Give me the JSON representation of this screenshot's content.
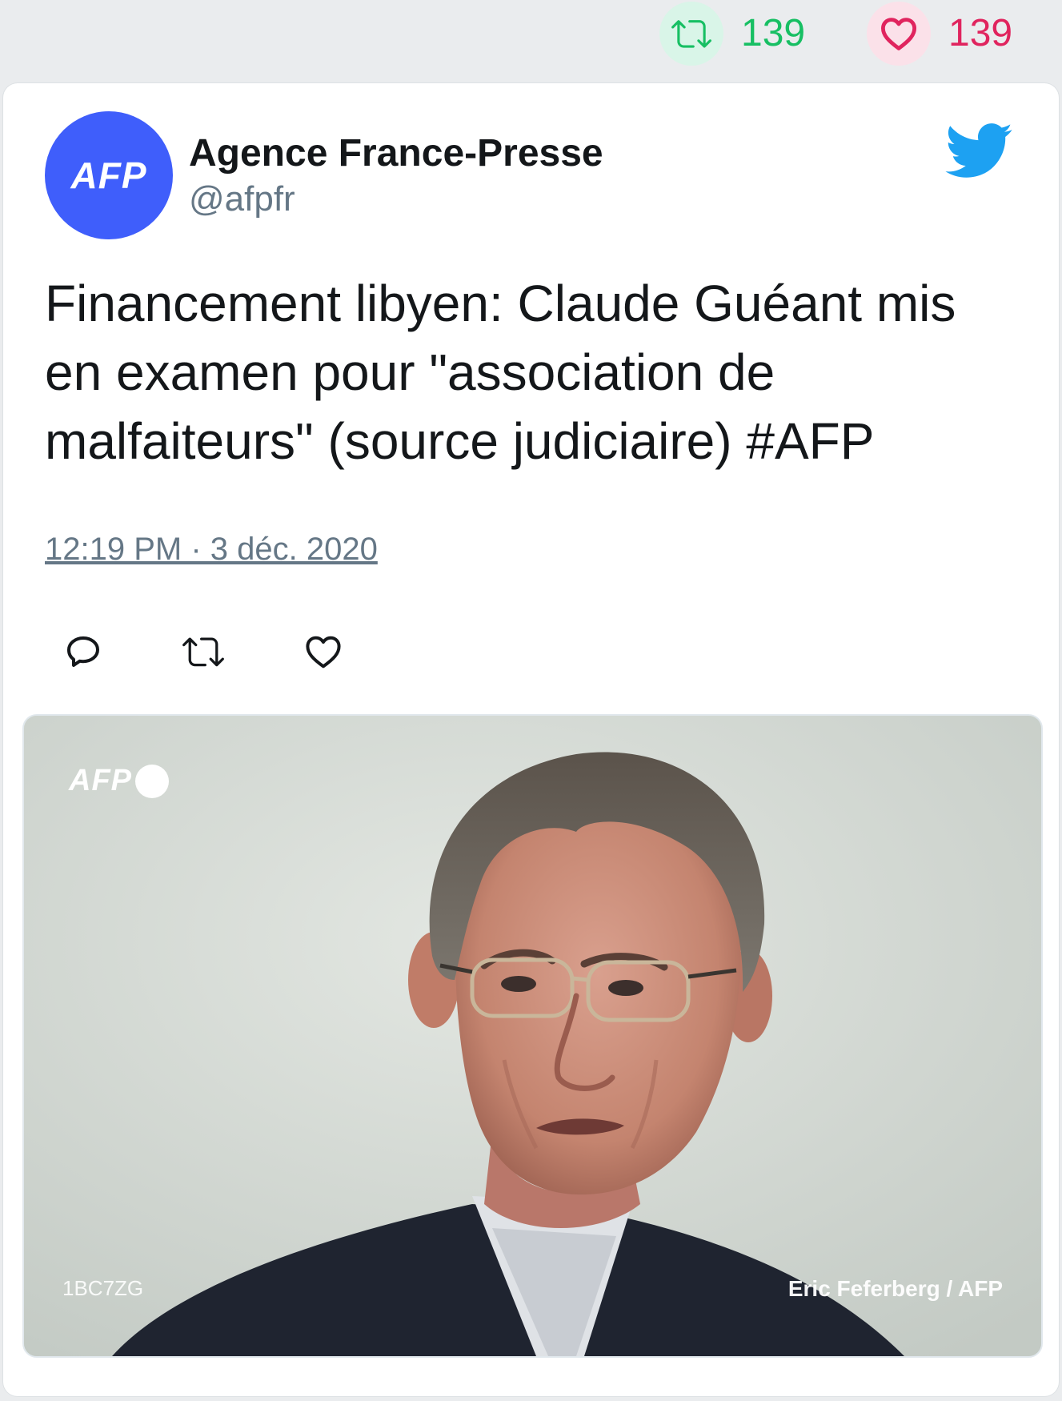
{
  "stats": {
    "retweet_count": "139",
    "like_count": "139",
    "colors": {
      "retweet": "#17bf63",
      "like": "#e0245e"
    }
  },
  "tweet": {
    "author": {
      "name": "Agence France-Presse",
      "handle": "@afpfr",
      "avatar_text": "AFP",
      "avatar_color": "#3f5efb"
    },
    "text": "Financement libyen: Claude Guéant mis en examen pour \"association de malfaiteurs\" (source judiciaire) #AFP",
    "timestamp": "12:19 PM · 3 déc. 2020",
    "brand_icon": "twitter-bird-icon",
    "brand_color": "#1da1f2",
    "actions": [
      {
        "icon": "reply-icon"
      },
      {
        "icon": "retweet-icon"
      },
      {
        "icon": "like-icon"
      }
    ],
    "media": {
      "watermark": "AFP",
      "photo_id": "1BC7ZG",
      "credit": "Eric Feferberg / AFP"
    }
  }
}
